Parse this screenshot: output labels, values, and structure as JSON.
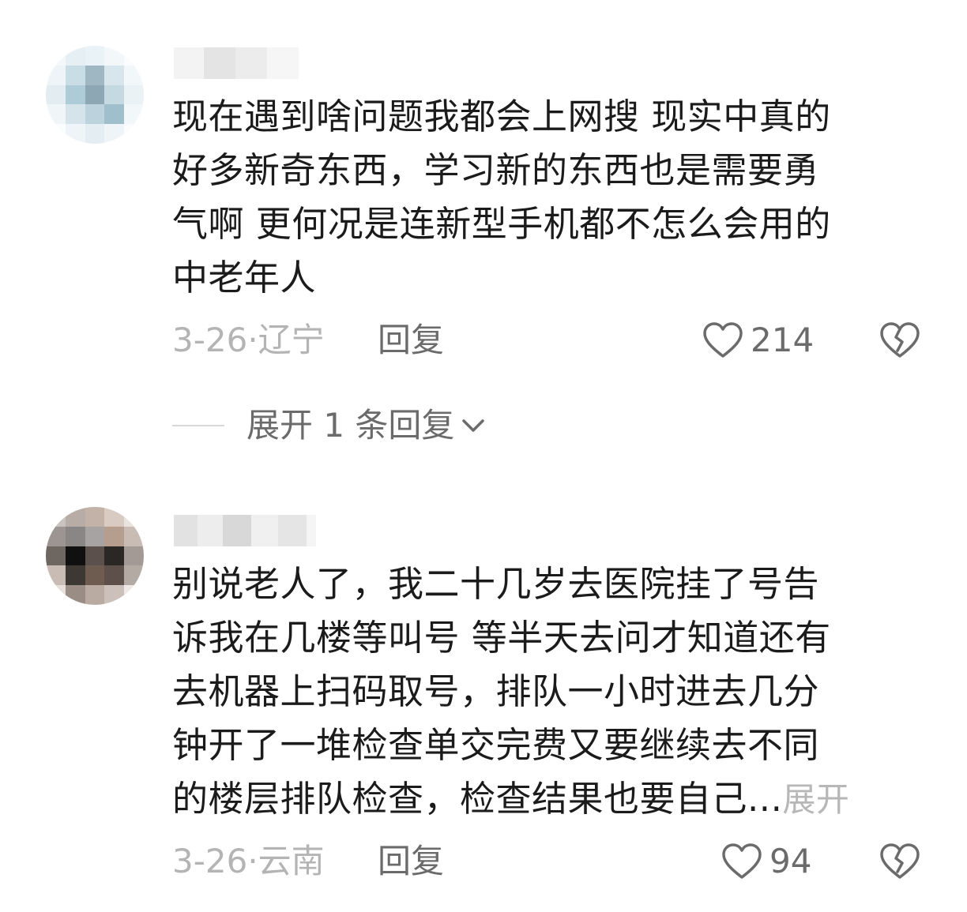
{
  "comments": [
    {
      "lines": [
        "现在遇到啥问题我都会上网搜 现实中真的",
        "好多新奇东西，学习新的东西也是需要勇",
        "气啊 更何况是连新型手机都不怎么会用的",
        "中老年人"
      ],
      "meta": "3-26·辽宁",
      "reply_label": "回复",
      "likes": "214"
    },
    {
      "lines": [
        "别说老人了，我二十几岁去医院挂了号告",
        "诉我在几楼等叫号 等半天去问才知道还有",
        "去机器上扫码取号，排队一小时进去几分",
        "钟开了一堆检查单交完费又要继续去不同",
        "的楼层排队检查，检查结果也要自己..."
      ],
      "expand_inline": "展开",
      "meta": "3-26·云南",
      "reply_label": "回复",
      "likes": "94"
    }
  ],
  "expand_replies": "展开 1 条回复",
  "colors": {
    "text": "#1b1b1b",
    "meta": "#b4b4b4",
    "action": "#6b6b6b"
  },
  "icons": [
    "heart-outline-icon",
    "broken-heart-icon",
    "chevron-down-icon"
  ]
}
